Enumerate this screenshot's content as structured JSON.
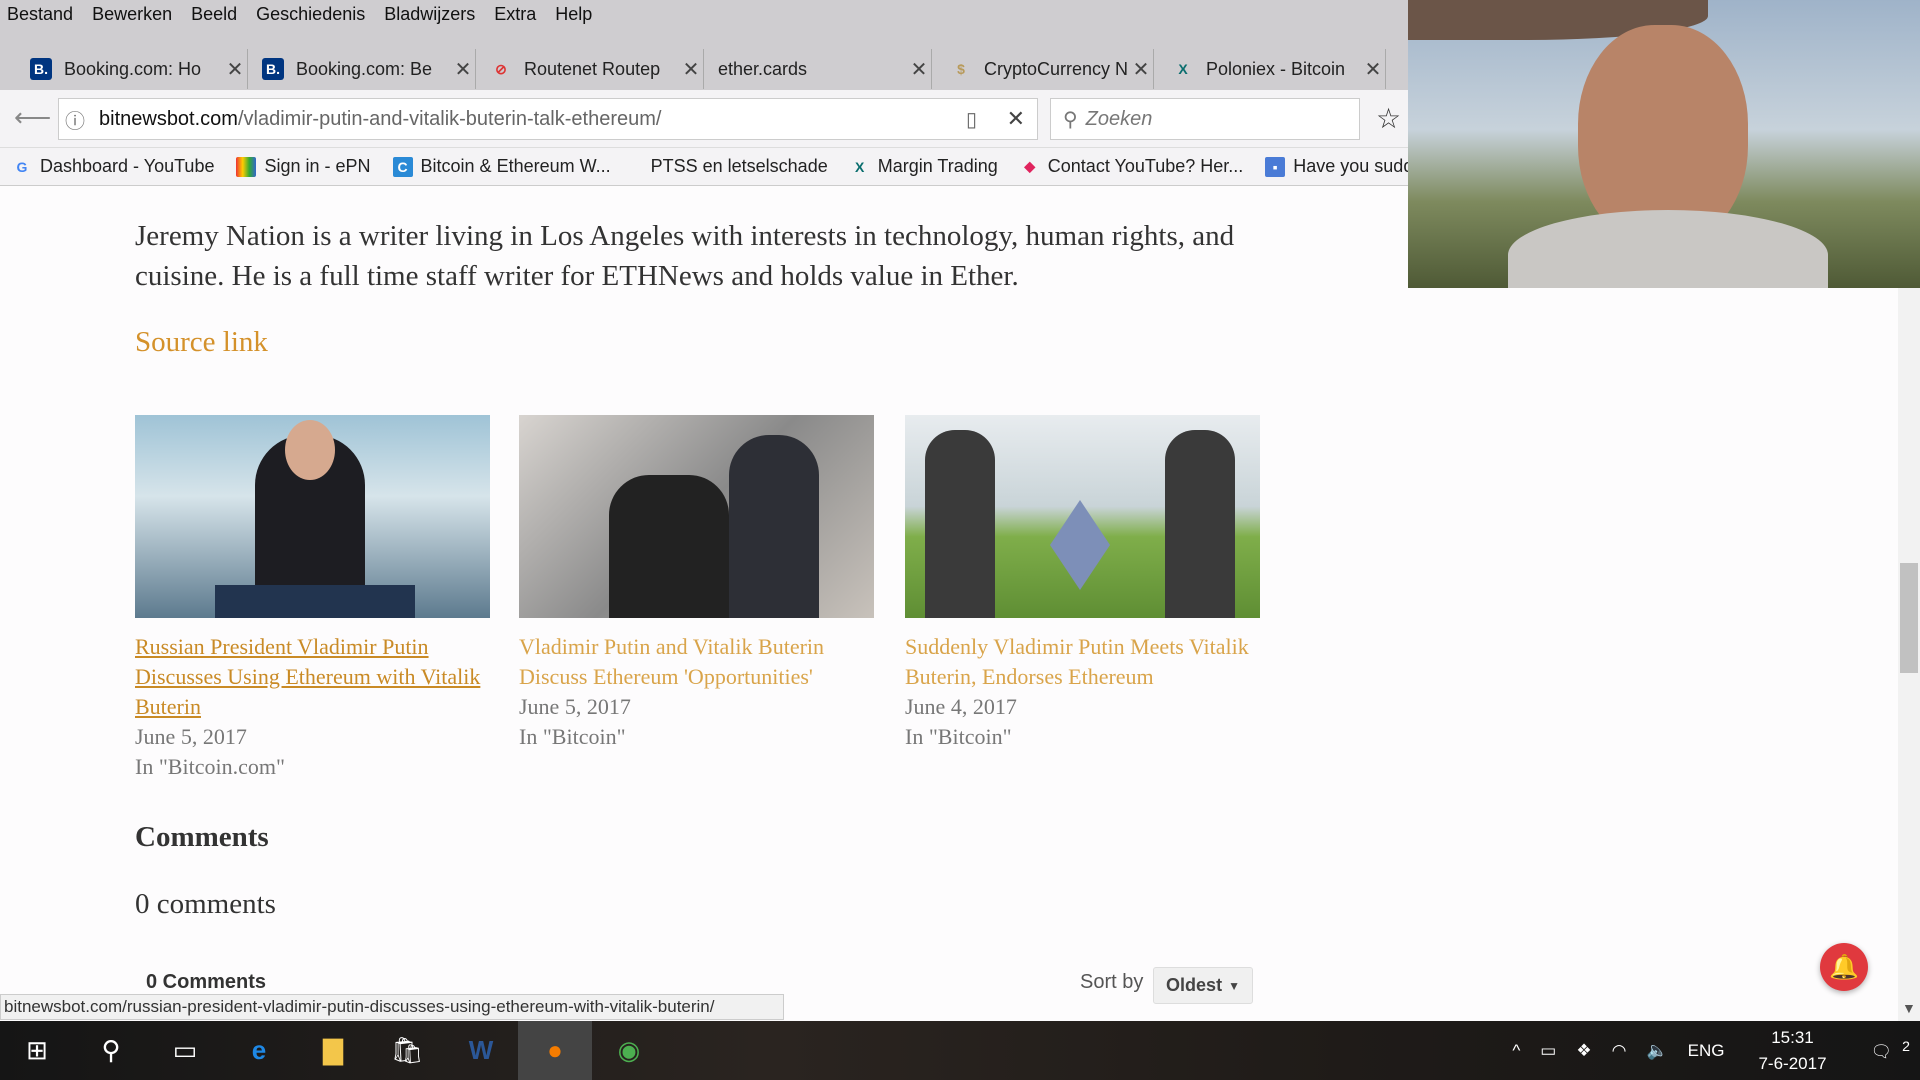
{
  "menu": [
    "Bestand",
    "Bewerken",
    "Beeld",
    "Geschiedenis",
    "Bladwijzers",
    "Extra",
    "Help"
  ],
  "tabs": [
    {
      "label": "Booking.com: Ho",
      "icon": "B.",
      "color": "#003580"
    },
    {
      "label": "Booking.com: Be",
      "icon": "B.",
      "color": "#003580"
    },
    {
      "label": "Routenet Routep",
      "icon": "⊘",
      "color": "#d33"
    },
    {
      "label": "ether.cards",
      "icon": "",
      "color": ""
    },
    {
      "label": "CryptoCurrency N",
      "icon": "$",
      "color": "#b89a5a"
    },
    {
      "label": "Poloniex - Bitcoin",
      "icon": "X",
      "color": "#0a6e6e"
    }
  ],
  "url": {
    "domain": "bitnewsbot.com",
    "path": "/vladimir-putin-and-vitalik-buterin-talk-ethereum/"
  },
  "search_placeholder": "Zoeken",
  "bookmarks": [
    "Dashboard - YouTube",
    "Sign in - ePN",
    "Bitcoin & Ethereum W...",
    "PTSS en letselschade",
    "Margin Trading",
    "Contact YouTube? Her...",
    "Have you suddenly h"
  ],
  "article": {
    "bio": "Jeremy Nation is a writer living in Los Angeles with interests in technology, human rights, and cuisine. He is a full time staff writer for ETHNews and holds value in Ether.",
    "source_link": "Source link"
  },
  "related": [
    {
      "title": "Russian President Vladimir Putin Discusses Using Ethereum with Vitalik Buterin",
      "date": "June 5, 2017",
      "category": "In \"Bitcoin.com\""
    },
    {
      "title": "Vladimir Putin and Vitalik Buterin Discuss Ethereum 'Opportunities'",
      "date": "June 5, 2017",
      "category": "In \"Bitcoin\""
    },
    {
      "title": "Suddenly Vladimir Putin Meets Vitalik Buterin, Endorses Ethereum",
      "date": "June 4, 2017",
      "category": "In \"Bitcoin\""
    }
  ],
  "comments": {
    "heading": "Comments",
    "count_text": "0 comments",
    "widget_count": "0 Comments",
    "sort_label": "Sort by",
    "sort_value": "Oldest"
  },
  "status_url": "bitnewsbot.com/russian-president-vladimir-putin-discusses-using-ethereum-with-vitalik-buterin/",
  "tray": {
    "lang": "ENG",
    "time": "15:31",
    "date": "7-6-2017",
    "notifications": "2"
  },
  "colors": {
    "link": "#d4912a",
    "bell": "#e0393e"
  }
}
